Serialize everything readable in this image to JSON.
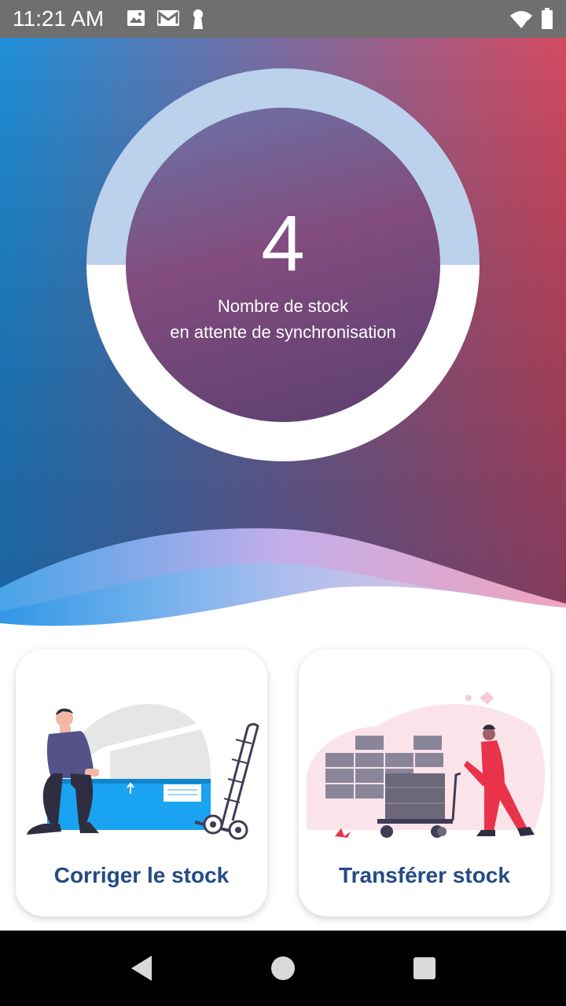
{
  "status_bar": {
    "time": "11:21 AM",
    "left_icons": [
      "image-icon",
      "gmail-icon",
      "keyhole-icon"
    ],
    "right_icons": [
      "wifi-icon",
      "battery-icon"
    ]
  },
  "sync": {
    "count": "4",
    "label_line1": "Nombre de stock",
    "label_line2": "en attente de synchronisation"
  },
  "actions": [
    {
      "label": "Corriger le stock",
      "icon": "worker-box-handtruck-illustration"
    },
    {
      "label": "Transférer stock",
      "icon": "worker-pushing-cart-illustration"
    }
  ],
  "nav": {
    "buttons": [
      "back-icon",
      "home-icon",
      "recents-icon"
    ]
  },
  "colors": {
    "gradient_left": "#1f8fd8",
    "gradient_middle": "#7c6ba0",
    "gradient_right": "#d34a62",
    "ring_top": "#bcd1ec",
    "card_title": "#234b86",
    "accent_blue": "#1aa3f0",
    "accent_red": "#e8334a"
  }
}
